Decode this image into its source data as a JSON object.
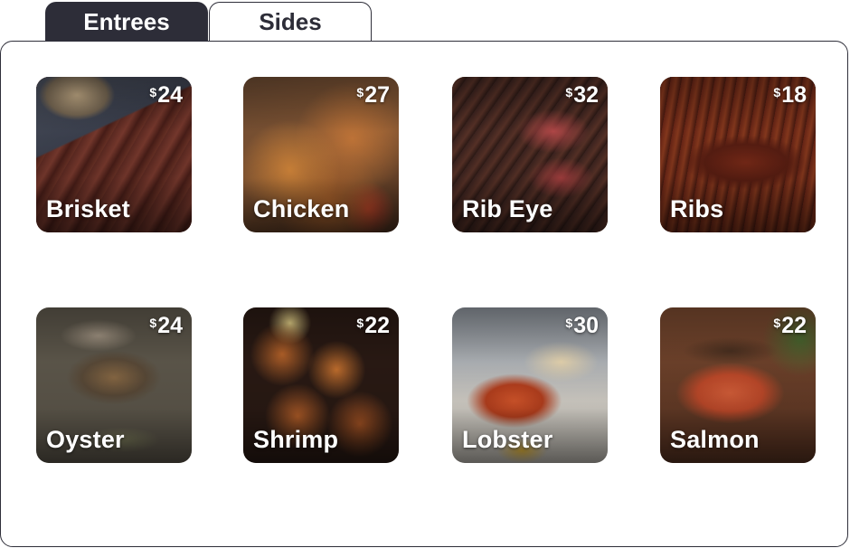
{
  "tabs": [
    {
      "label": "Entrees",
      "active": true
    },
    {
      "label": "Sides",
      "active": false
    }
  ],
  "currency_symbol": "$",
  "items": [
    {
      "name": "Brisket",
      "price": "24"
    },
    {
      "name": "Chicken",
      "price": "27"
    },
    {
      "name": "Rib Eye",
      "price": "32"
    },
    {
      "name": "Ribs",
      "price": "18"
    },
    {
      "name": "Oyster",
      "price": "24"
    },
    {
      "name": "Shrimp",
      "price": "22"
    },
    {
      "name": "Lobster",
      "price": "30"
    },
    {
      "name": "Salmon",
      "price": "22"
    }
  ],
  "colors": {
    "tab_active_bg": "#2d2d38",
    "tab_text_active": "#ffffff",
    "border": "#2f2f3a"
  }
}
